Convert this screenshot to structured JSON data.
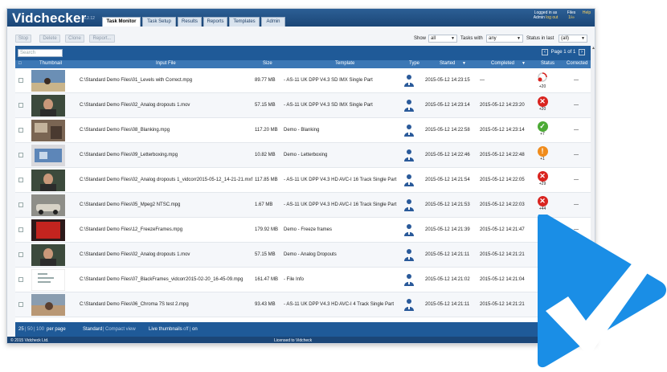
{
  "app": {
    "name": "Vidchecker",
    "version": "6.2.12"
  },
  "tabs": [
    "Task Monitor",
    "Task Setup",
    "Results",
    "Reports",
    "Templates",
    "Admin"
  ],
  "user": {
    "line1": "Logged in as",
    "line2_prefix": "Admin",
    "line2_link": "log out",
    "files_label": "Files",
    "files_value": "1/∞",
    "help": "Help"
  },
  "toolbar": {
    "stop": "Stop",
    "delete": "Delete",
    "clone": "Clone",
    "report": "Report..."
  },
  "filters": {
    "show_label": "Show",
    "show_value": "all",
    "tasks_label": "Tasks with",
    "tasks_value": "any",
    "status_label": "Status in last",
    "status_value": "(all)"
  },
  "search_placeholder": "Search",
  "pager": {
    "text": "Page 1 of 1"
  },
  "columns": [
    "Thumbnail",
    "Input File",
    "Size",
    "Template",
    "Type",
    "Started",
    "Completed",
    "Status",
    "Corrected"
  ],
  "rows": [
    {
      "file": "C:\\Standard Demo Files\\01_Levels with Correct.mpg",
      "size": "89.77 MB",
      "template": "- AS-11 UK DPP V4.3 SD IMX Single Part",
      "started": "2015-05-12 14:23:15",
      "completed": "—",
      "status": "progress",
      "status_count": "+20",
      "corrected": "—",
      "thumb": "beach"
    },
    {
      "file": "C:\\Standard Demo Files\\02_Analog dropouts 1.mov",
      "size": "57.15 MB",
      "template": "- AS-11 UK DPP V4.3 SD IMX Single Part",
      "started": "2015-05-12 14:23:14",
      "completed": "2015-05-12 14:23:20",
      "status": "fail",
      "status_count": "+20",
      "corrected": "—",
      "thumb": "person"
    },
    {
      "file": "C:\\Standard Demo Files\\08_Blanking.mpg",
      "size": "117.20 MB",
      "template": "Demo - Blanking",
      "started": "2015-05-12 14:22:58",
      "completed": "2015-05-12 14:23:14",
      "status": "pass",
      "status_count": "+7",
      "corrected": "—",
      "thumb": "room"
    },
    {
      "file": "C:\\Standard Demo Files\\09_Letterboxing.mpg",
      "size": "10.82 MB",
      "template": "Demo - Letterboxing",
      "started": "2015-05-12 14:22:46",
      "completed": "2015-05-12 14:22:48",
      "status": "warn",
      "status_count": "+1",
      "corrected": "—",
      "thumb": "letterbox"
    },
    {
      "file": "C:\\Standard Demo Files\\02_Analog dropouts 1_vidcorr2015-05-12_14-21-21.mxf",
      "size": "117.85 MB",
      "template": "- AS-11 UK DPP V4.3 HD AVC-I 16 Track Single Part",
      "started": "2015-05-12 14:21:54",
      "completed": "2015-05-12 14:22:05",
      "status": "fail",
      "status_count": "+29",
      "corrected": "—",
      "thumb": "person"
    },
    {
      "file": "C:\\Standard Demo Files\\05_Mpeg2 NTSC.mpg",
      "size": "1.67 MB",
      "template": "- AS-11 UK DPP V4.3 HD AVC-I 16 Track Single Part",
      "started": "2015-05-12 14:21:53",
      "completed": "2015-05-12 14:22:03",
      "status": "fail",
      "status_count": "+44",
      "corrected": "—",
      "thumb": "car"
    },
    {
      "file": "C:\\Standard Demo Files\\12_FreezeFrames.mpg",
      "size": "179.92 MB",
      "template": "Demo - Freeze frames",
      "started": "2015-05-12 14:21:39",
      "completed": "2015-05-12 14:21:47",
      "status": "none",
      "status_count": "",
      "corrected": "—",
      "thumb": "red"
    },
    {
      "file": "C:\\Standard Demo Files\\02_Analog dropouts 1.mov",
      "size": "57.15 MB",
      "template": "Demo - Analog Dropouts",
      "started": "2015-05-12 14:21:11",
      "completed": "2015-05-12 14:21:21",
      "status": "none",
      "status_count": "",
      "corrected": "—",
      "thumb": "person"
    },
    {
      "file": "C:\\Standard Demo Files\\07_BlackFrames_vidcorr2015-02-20_16-45-09.mpg",
      "size": "161.47 MB",
      "template": "- File Info",
      "started": "2015-05-12 14:21:02",
      "completed": "2015-05-12 14:21:04",
      "status": "none",
      "status_count": "",
      "corrected": "—",
      "thumb": "doc"
    },
    {
      "file": "C:\\Standard Demo Files\\06_Chroma 7S test 2.mpg",
      "size": "93.43 MB",
      "template": "- AS-11 UK DPP V4.3 HD AVC-I 4 Track Single Part",
      "started": "2015-05-12 14:21:11",
      "completed": "2015-05-12 14:21:21",
      "status": "none",
      "status_count": "",
      "corrected": "—",
      "thumb": "beach2"
    }
  ],
  "footer": {
    "pp25": "25",
    "pp50": "50",
    "pp100": "100",
    "per_page": "per page",
    "standard": "Standard",
    "compact": "Compact view",
    "live_label": "Live thumbnails",
    "live_off": "off",
    "live_on": "on"
  },
  "bottombar": {
    "copyright": "© 2015 Vidcheck Ltd.",
    "licensed": "Licensed to Vidcheck"
  },
  "colors": {
    "header": "#1f5a98",
    "brand_blue": "#1a8ee6",
    "fail": "#d9241f",
    "pass": "#4caa35",
    "warn": "#f08c1c"
  }
}
